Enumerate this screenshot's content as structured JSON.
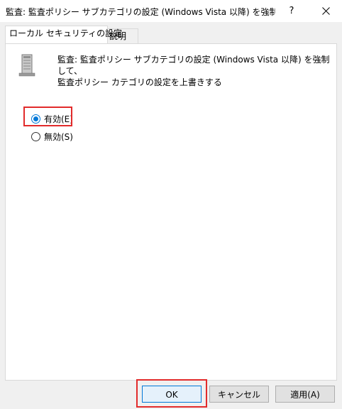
{
  "window": {
    "title": "監査: 監査ポリシー サブカテゴリの設定 (Windows Vista 以降) を強制して、監...",
    "help_label": "?"
  },
  "tabs": [
    {
      "label": "ローカル セキュリティの設定",
      "active": true
    },
    {
      "label": "説明",
      "active": false
    }
  ],
  "policy": {
    "icon": "server-icon",
    "description_line1": "監査: 監査ポリシー サブカテゴリの設定 (Windows Vista 以降) を強制して、",
    "description_line2": "監査ポリシー カテゴリの設定を上書きする"
  },
  "options": {
    "enabled_label": "有効(E)",
    "disabled_label": "無効(S)",
    "selected": "enabled"
  },
  "buttons": {
    "ok": "OK",
    "cancel": "キャンセル",
    "apply": "適用(A)"
  },
  "colors": {
    "highlight": "#e22b2b",
    "accent": "#0078d7"
  }
}
